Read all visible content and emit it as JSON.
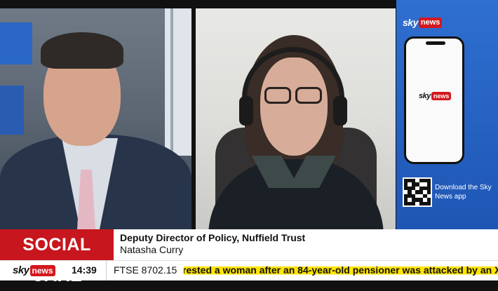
{
  "brand": {
    "sky": "sky",
    "news": "news",
    "colors": {
      "red": "#d4181e",
      "blue": "#2f6fd0",
      "ticker_highlight": "#ffe400"
    }
  },
  "sidebar": {
    "download_text": "Download the Sky News app",
    "qr_icon": "qr-code-icon",
    "phone_icon": "smartphone-icon"
  },
  "lower_third": {
    "topic": "SOCIAL CARE",
    "headline": "Deputy Director of Policy, Nuffield Trust",
    "subline": "Natasha Curry"
  },
  "ticker": {
    "time": "14:39",
    "market": "FTSE 8702.15",
    "scroll_text": "rested a woman after an 84-year-old pensioner was attacked by an XL"
  }
}
